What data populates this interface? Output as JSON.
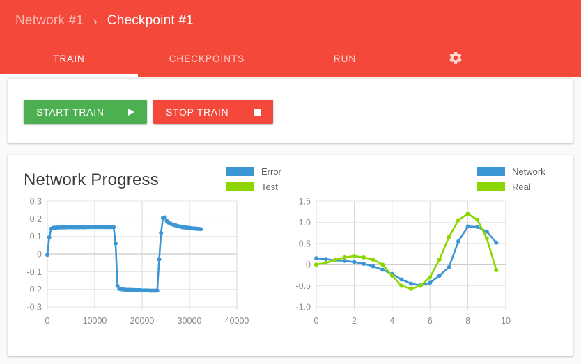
{
  "header": {
    "bg_color": "#f4483a",
    "breadcrumb": {
      "parent": "Network #1",
      "separator": "›",
      "current": "Checkpoint #1"
    },
    "tabs": [
      {
        "id": "train",
        "label": "TRAIN",
        "active": true
      },
      {
        "id": "checkpoints",
        "label": "CHECKPOINTS",
        "active": false
      },
      {
        "id": "run",
        "label": "RUN",
        "active": false
      }
    ],
    "settings_icon": "gear-icon"
  },
  "train_card": {
    "start_button": {
      "label": "START TRAIN",
      "icon": "play-icon",
      "color": "#4caf50"
    },
    "stop_button": {
      "label": "STOP TRAIN",
      "icon": "stop-square-icon",
      "color": "#f4483a"
    }
  },
  "progress_card": {
    "title": "Network Progress"
  },
  "chart_data": [
    {
      "id": "error-chart",
      "type": "line",
      "title": "",
      "xlabel": "",
      "ylabel": "",
      "xlim": [
        0,
        40000
      ],
      "ylim": [
        -0.3,
        0.3
      ],
      "xticks": [
        "0",
        "10000",
        "20000",
        "30000",
        "40000"
      ],
      "xtick_values": [
        0,
        10000,
        20000,
        30000,
        40000
      ],
      "yticks": [
        "0.3",
        "0.2",
        "0.1",
        "0",
        "-0.1",
        "-0.2",
        "-0.3"
      ],
      "ytick_values": [
        0.3,
        0.2,
        0.1,
        0,
        -0.1,
        -0.2,
        -0.3
      ],
      "grid": true,
      "legend_position": "right",
      "series": [
        {
          "name": "Error",
          "color": "#3d96d4",
          "markers": true,
          "x": [
            0,
            400,
            800,
            1200,
            1600,
            2000,
            2400,
            2800,
            3200,
            3600,
            4000,
            4400,
            4800,
            5200,
            5600,
            6000,
            6400,
            6800,
            7200,
            7600,
            8000,
            8400,
            8800,
            9200,
            9600,
            10000,
            10400,
            10800,
            11200,
            11600,
            12000,
            12400,
            12800,
            13200,
            13600,
            14000,
            14400,
            14800,
            15200,
            15600,
            16000,
            16400,
            16800,
            17200,
            17600,
            18000,
            18400,
            18800,
            19200,
            19600,
            20000,
            20400,
            20800,
            21200,
            21600,
            22000,
            22400,
            22800,
            23200,
            23600,
            24000,
            24400,
            24800,
            25200,
            25600,
            26000,
            26400,
            26800,
            27200,
            27600,
            28000,
            28400,
            28800,
            29200,
            29600,
            30000,
            30400,
            30800,
            31200,
            31600,
            32000,
            32400
          ],
          "y": [
            -0.005,
            0.095,
            0.143,
            0.148,
            0.149,
            0.15,
            0.15,
            0.151,
            0.151,
            0.151,
            0.152,
            0.152,
            0.152,
            0.152,
            0.152,
            0.152,
            0.152,
            0.152,
            0.152,
            0.152,
            0.152,
            0.153,
            0.153,
            0.153,
            0.153,
            0.153,
            0.153,
            0.153,
            0.153,
            0.153,
            0.153,
            0.153,
            0.153,
            0.153,
            0.153,
            0.152,
            0.06,
            -0.18,
            -0.197,
            -0.2,
            -0.201,
            -0.202,
            -0.203,
            -0.203,
            -0.204,
            -0.204,
            -0.204,
            -0.205,
            -0.205,
            -0.205,
            -0.206,
            -0.206,
            -0.206,
            -0.206,
            -0.207,
            -0.207,
            -0.207,
            -0.207,
            -0.207,
            -0.03,
            0.12,
            0.205,
            0.207,
            0.188,
            0.178,
            0.172,
            0.168,
            0.164,
            0.161,
            0.158,
            0.156,
            0.153,
            0.151,
            0.15,
            0.149,
            0.148,
            0.146,
            0.145,
            0.144,
            0.143,
            0.142,
            0.141
          ]
        },
        {
          "name": "Test",
          "color": "#8cd600",
          "markers": true,
          "x": [],
          "y": []
        }
      ],
      "legend": [
        {
          "label": "Error",
          "color": "#3d96d4"
        },
        {
          "label": "Test",
          "color": "#8cd600"
        }
      ]
    },
    {
      "id": "network-vs-real-chart",
      "type": "line",
      "title": "",
      "xlabel": "",
      "ylabel": "",
      "xlim": [
        0,
        10
      ],
      "ylim": [
        -1.0,
        1.5
      ],
      "xticks": [
        "0",
        "2",
        "4",
        "6",
        "8",
        "10"
      ],
      "xtick_values": [
        0,
        2,
        4,
        6,
        8,
        10
      ],
      "yticks": [
        "1.5",
        "1.0",
        "0.5",
        "0",
        "-0.5",
        "-1.0"
      ],
      "ytick_values": [
        1.5,
        1.0,
        0.5,
        0,
        -0.5,
        -1.0
      ],
      "grid": true,
      "legend_position": "right",
      "series": [
        {
          "name": "Network",
          "color": "#3d96d4",
          "markers": true,
          "x": [
            0,
            0.5,
            1.0,
            1.5,
            2.0,
            2.5,
            3.0,
            3.5,
            4.0,
            4.5,
            5.0,
            5.5,
            6.0,
            6.5,
            7.0,
            7.5,
            8.0,
            8.5,
            9.0,
            9.5
          ],
          "y": [
            0.15,
            0.13,
            0.1,
            0.09,
            0.06,
            0.02,
            -0.04,
            -0.12,
            -0.22,
            -0.35,
            -0.45,
            -0.49,
            -0.43,
            -0.26,
            -0.06,
            0.55,
            0.9,
            0.89,
            0.78,
            0.52
          ]
        },
        {
          "name": "Real",
          "color": "#8cd600",
          "markers": true,
          "x": [
            0,
            0.5,
            1.0,
            1.5,
            2.0,
            2.5,
            3.0,
            3.5,
            4.0,
            4.5,
            5.0,
            5.5,
            6.0,
            6.5,
            7.0,
            7.5,
            8.0,
            8.5,
            9.0,
            9.5
          ],
          "y": [
            0.0,
            0.04,
            0.11,
            0.17,
            0.2,
            0.17,
            0.12,
            0.0,
            -0.26,
            -0.5,
            -0.57,
            -0.5,
            -0.3,
            0.12,
            0.65,
            1.05,
            1.2,
            1.06,
            0.62,
            -0.13
          ]
        }
      ],
      "legend": [
        {
          "label": "Network",
          "color": "#3d96d4"
        },
        {
          "label": "Real",
          "color": "#8cd600"
        }
      ]
    }
  ]
}
